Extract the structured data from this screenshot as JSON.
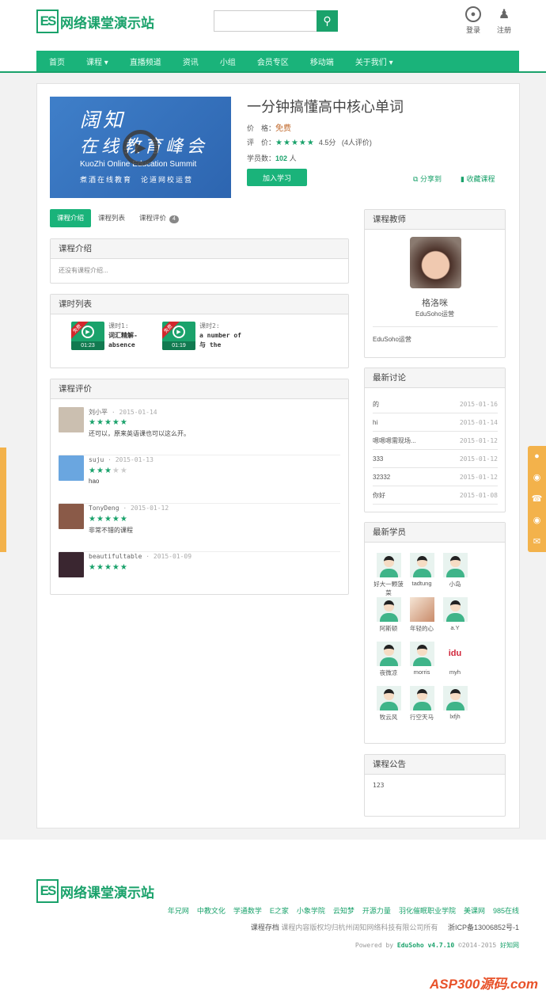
{
  "header": {
    "site_name": "网络课堂演示站",
    "logo_mark": "ES",
    "search_placeholder": "",
    "login": "登录",
    "register": "注册"
  },
  "nav": [
    "首页",
    "课程 ▾",
    "直播频道",
    "资讯",
    "小组",
    "会员专区",
    "移动端",
    "关于我们 ▾"
  ],
  "course": {
    "cover_line1": "阔知",
    "cover_line2": "在线教育峰会",
    "cover_en": "KuoZhi Online Education Summit",
    "cover_tagline": "煮酒在线教育　论道网校运营",
    "title": "一分钟搞懂高中核心单词",
    "price_label": "价　格：",
    "price": "免费",
    "rating_label": "评　价：",
    "rating_stars": 5,
    "rating_score": "4.5分",
    "rating_count": "(4人评价)",
    "students_label": "学员数：",
    "students": "102",
    "students_unit": "人",
    "join": "加入学习",
    "share": "分享到",
    "favorite": "收藏课程"
  },
  "tabs": [
    {
      "label": "课程介绍"
    },
    {
      "label": "课程列表"
    },
    {
      "label": "课程评价",
      "badge": "4"
    }
  ],
  "intro": {
    "title": "课程介绍",
    "text": "还没有课程介绍..."
  },
  "lessons": {
    "title": "课时列表",
    "free": "免费",
    "items": [
      {
        "num": "课时1:",
        "name": "词汇精解-absence",
        "duration": "01:23"
      },
      {
        "num": "课时2:",
        "name": "a number of 与 the",
        "duration": "01:19"
      }
    ]
  },
  "reviews": {
    "title": "课程评价",
    "items": [
      {
        "user": "刘小平",
        "date": "2015-01-14",
        "stars": 5,
        "text": "还可以，原来英语课也可以这么开。",
        "color": "#cbbfb0"
      },
      {
        "user": "suju",
        "date": "2015-01-13",
        "stars": 3,
        "text": "hao",
        "color": "#6aa6e0"
      },
      {
        "user": "TonyDeng",
        "date": "2015-01-12",
        "stars": 5,
        "text": "非常不错的课程",
        "color": "#8a5a48"
      },
      {
        "user": "beautifultable",
        "date": "2015-01-09",
        "stars": 5,
        "text": "",
        "color": "#3a2630"
      }
    ]
  },
  "teacher": {
    "title": "课程教师",
    "name": "格洛咪",
    "role": "EduSoho运营",
    "about": "EduSoho运营"
  },
  "discussions": {
    "title": "最新讨论",
    "items": [
      {
        "t": "的",
        "d": "2015-01-16"
      },
      {
        "t": "hi",
        "d": "2015-01-14"
      },
      {
        "t": "嗯嗯嗯需现场...",
        "d": "2015-01-12"
      },
      {
        "t": "333",
        "d": "2015-01-12"
      },
      {
        "t": "32332",
        "d": "2015-01-12"
      },
      {
        "t": "你好",
        "d": "2015-01-08"
      }
    ]
  },
  "students": {
    "title": "最新学员",
    "items": [
      "好大一颗菠菜",
      "tadtung",
      "小岛",
      "阿斯顿",
      "年轻的心",
      "a.Y",
      "夜微凉",
      "morris",
      "myh",
      "牧云风",
      "行空天马",
      "lxfjh"
    ]
  },
  "notice": {
    "title": "课程公告",
    "text": "123"
  },
  "footer": {
    "site_name": "网络课堂演示站",
    "links": [
      "年兄网",
      "中教文化",
      "学通数学",
      "E之家",
      "小象学院",
      "云知梦",
      "开源力量",
      "羽化催眠职业学院",
      "美课网",
      "985在线"
    ],
    "archive": "课程存档",
    "copyright": "课程内容版权均归杭州阔知网络科技有限公司所有",
    "icp": "浙ICP备13006852号-1",
    "powered": "Powered by",
    "eduso": "EduSoho v4.7.10",
    "years": "©2014-2015",
    "brand": "好知网",
    "watermark": "ASP300源码.com"
  },
  "colors": {
    "accent": "#1ab37a",
    "price": "#c0682b",
    "side": "#f3b24b"
  }
}
